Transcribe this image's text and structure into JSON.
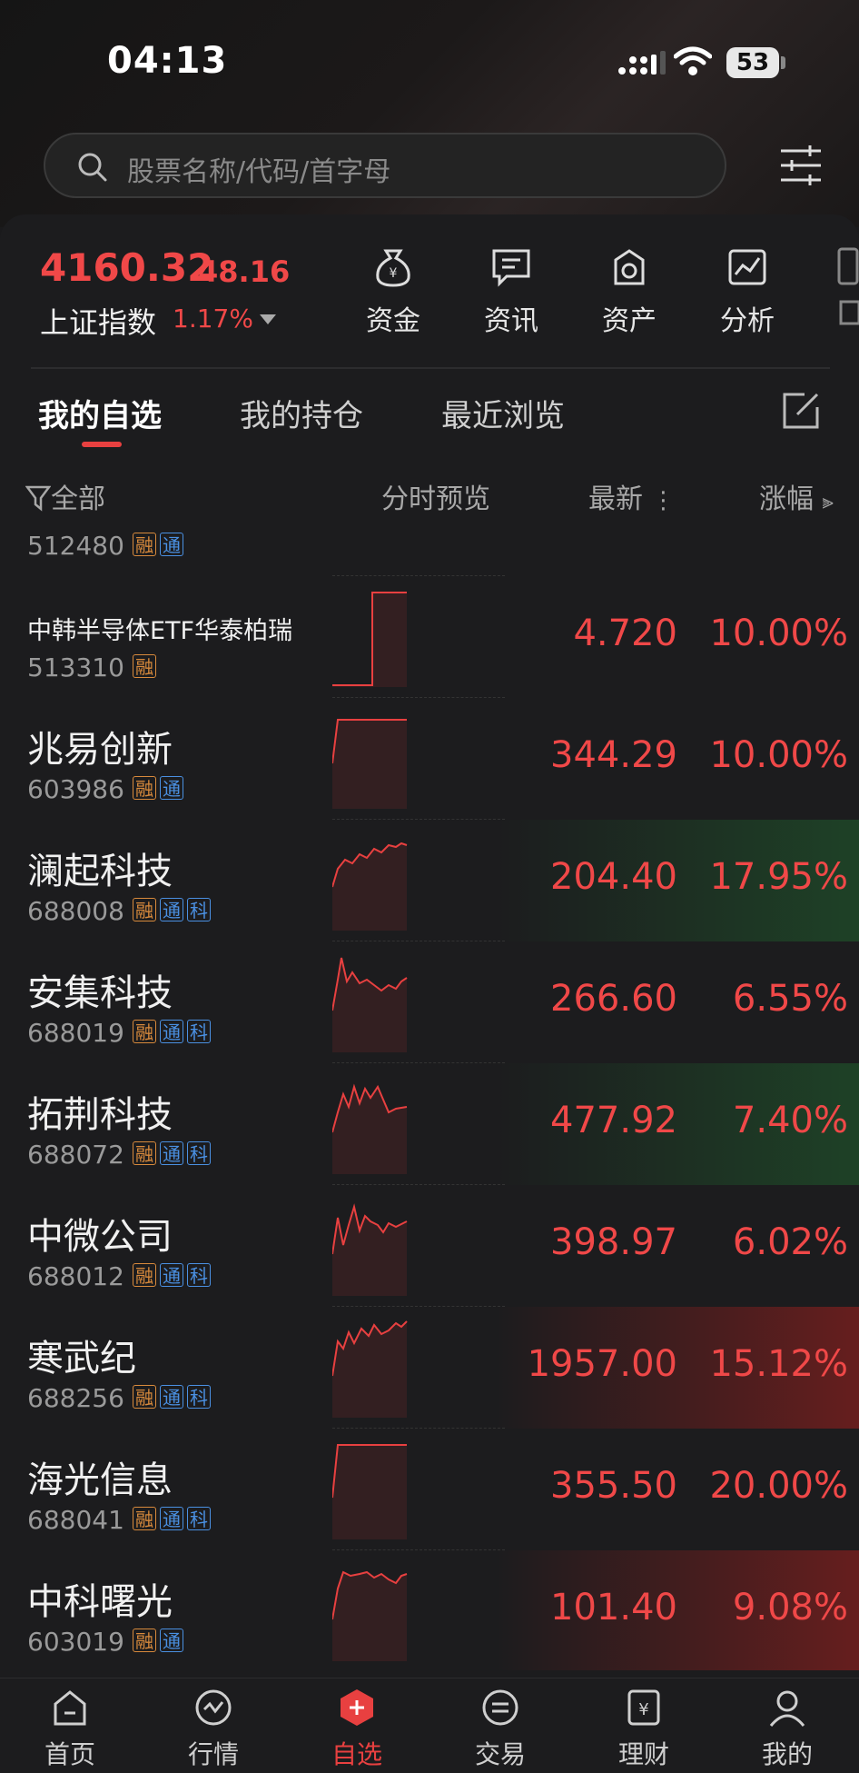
{
  "status_bar": {
    "time": "04:13",
    "battery": "53"
  },
  "search": {
    "placeholder": "股票名称/代码/首字母"
  },
  "index": {
    "value": "4160.32",
    "change": "48.16",
    "name": "上证指数",
    "change_pct": "1.17%"
  },
  "quick_actions": [
    {
      "label": "资金",
      "icon": "money-bag-icon"
    },
    {
      "label": "资讯",
      "icon": "news-icon"
    },
    {
      "label": "资产",
      "icon": "asset-icon"
    },
    {
      "label": "分析",
      "icon": "analysis-icon"
    }
  ],
  "tabs": [
    {
      "label": "我的自选",
      "active": true
    },
    {
      "label": "我的持仓",
      "active": false
    },
    {
      "label": "最近浏览",
      "active": false
    }
  ],
  "columns": {
    "all": "全部",
    "preview": "分时预览",
    "latest": "最新",
    "change": "涨幅"
  },
  "partial_row_code": "512480",
  "stocks": [
    {
      "name": "中韩半导体ETF华泰柏瑞",
      "code": "513310",
      "tags": [
        "融"
      ],
      "price": "4.720",
      "change": "10.00%",
      "highlight": "none"
    },
    {
      "name": "兆易创新",
      "code": "603986",
      "tags": [
        "融",
        "通"
      ],
      "price": "344.29",
      "change": "10.00%",
      "highlight": "none"
    },
    {
      "name": "澜起科技",
      "code": "688008",
      "tags": [
        "融",
        "通",
        "科"
      ],
      "price": "204.40",
      "change": "17.95%",
      "highlight": "green"
    },
    {
      "name": "安集科技",
      "code": "688019",
      "tags": [
        "融",
        "通",
        "科"
      ],
      "price": "266.60",
      "change": "6.55%",
      "highlight": "none"
    },
    {
      "name": "拓荆科技",
      "code": "688072",
      "tags": [
        "融",
        "通",
        "科"
      ],
      "price": "477.92",
      "change": "7.40%",
      "highlight": "green"
    },
    {
      "name": "中微公司",
      "code": "688012",
      "tags": [
        "融",
        "通",
        "科"
      ],
      "price": "398.97",
      "change": "6.02%",
      "highlight": "none"
    },
    {
      "name": "寒武纪",
      "code": "688256",
      "tags": [
        "融",
        "通",
        "科"
      ],
      "price": "1957.00",
      "change": "15.12%",
      "highlight": "red"
    },
    {
      "name": "海光信息",
      "code": "688041",
      "tags": [
        "融",
        "通",
        "科"
      ],
      "price": "355.50",
      "change": "20.00%",
      "highlight": "none"
    },
    {
      "name": "中科曙光",
      "code": "603019",
      "tags": [
        "融",
        "通"
      ],
      "price": "101.40",
      "change": "9.08%",
      "highlight": "red"
    }
  ],
  "bottom_nav": [
    {
      "label": "首页",
      "icon": "home-icon",
      "active": false
    },
    {
      "label": "行情",
      "icon": "market-icon",
      "active": false
    },
    {
      "label": "自选",
      "icon": "watchlist-plus-icon",
      "active": true
    },
    {
      "label": "交易",
      "icon": "trade-icon",
      "active": false
    },
    {
      "label": "理财",
      "icon": "wealth-icon",
      "active": false
    },
    {
      "label": "我的",
      "icon": "profile-icon",
      "active": false
    }
  ],
  "colors": {
    "up": "#f04848",
    "accent": "#e84040",
    "tag_rong": "#d88a3c",
    "tag_tong": "#4a90e2"
  }
}
